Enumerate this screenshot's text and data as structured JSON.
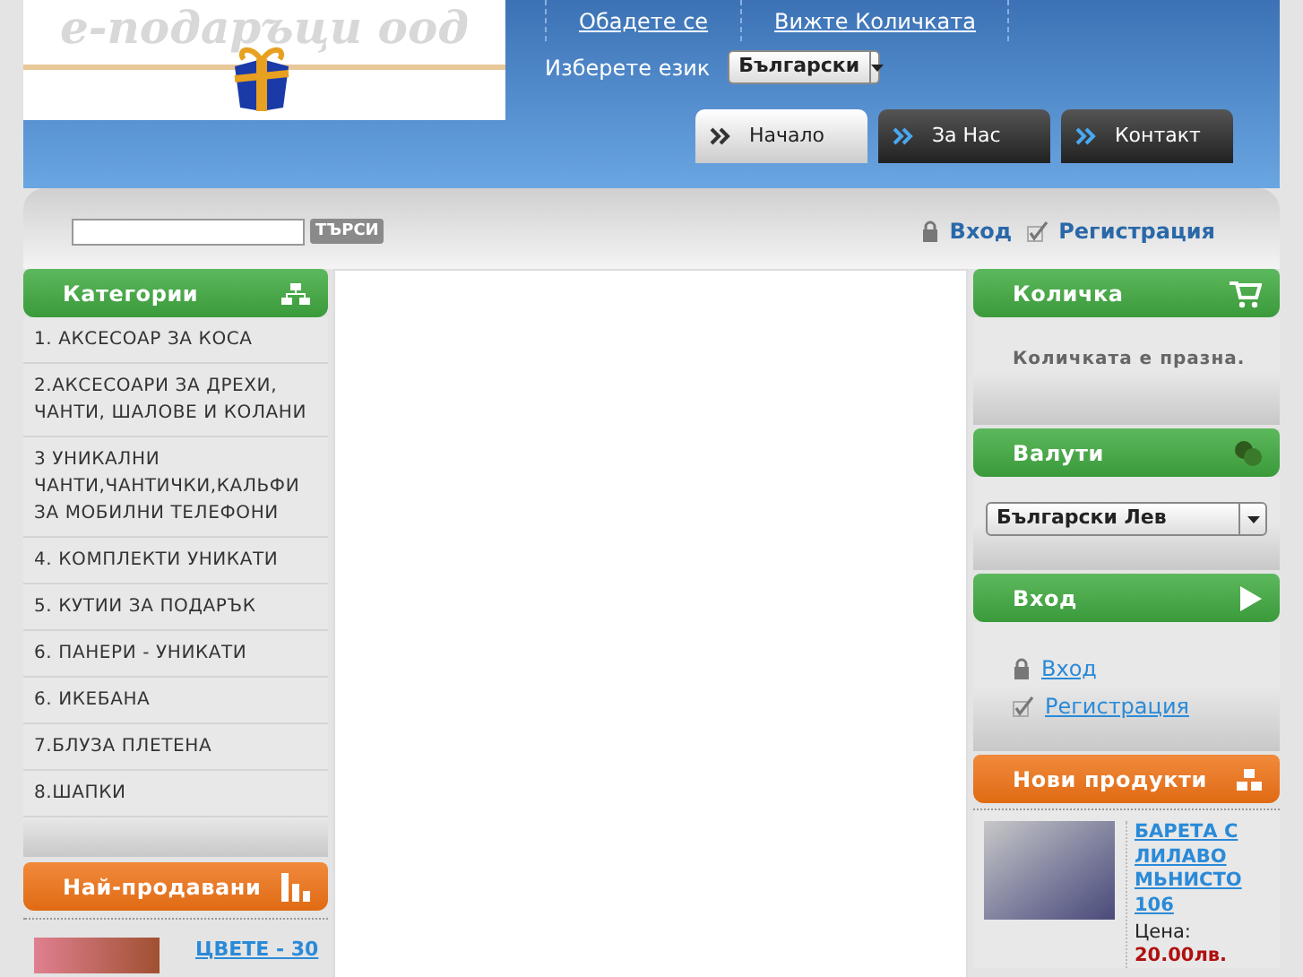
{
  "header": {
    "logo_text": "е-подаръци оод",
    "top_links": [
      "Обадете се",
      "Вижте Количката"
    ],
    "language_label": "Изберете език",
    "language_select": "Български",
    "nav_tabs": [
      {
        "label": "Начало",
        "selected": true
      },
      {
        "label": "За Нас",
        "selected": false
      },
      {
        "label": "Контакт",
        "selected": false
      }
    ]
  },
  "search": {
    "button": "ТЪРСИ",
    "auth_links": [
      {
        "kind": "login",
        "label": "Вход"
      },
      {
        "kind": "register",
        "label": "Регистрация"
      }
    ]
  },
  "left": {
    "categories": {
      "title": "Категории",
      "items": [
        "1. АКСЕСОАР ЗА КОСА",
        "2.АКСЕСОАРИ ЗА ДРЕХИ, ЧАНТИ, ШАЛОВЕ И КОЛАНИ",
        "3 УНИКАЛНИ ЧАНТИ,ЧАНТИЧКИ,КАЛЬФИ ЗА МОБИЛНИ ТЕЛЕФОНИ",
        "4. КОМПЛЕКТИ УНИКАТИ",
        "5. КУТИИ ЗА ПОДАРЪК",
        "6. ПАНЕРИ - УНИКАТИ",
        "6. ИКЕБАНА",
        "7.БЛУЗА ПЛЕТЕНА",
        "8.ШАПКИ"
      ]
    },
    "bestsellers": {
      "title": "Най-продавани",
      "products": [
        {
          "name": "ЦВЕТЕ - 30"
        }
      ]
    }
  },
  "right": {
    "cart": {
      "title": "Количка",
      "empty_text": "Количката е празна."
    },
    "currencies": {
      "title": "Валути",
      "select": "Български Лев"
    },
    "login": {
      "title": "Вход",
      "links": [
        {
          "kind": "login",
          "label": "Вход"
        },
        {
          "kind": "register",
          "label": "Регистрация"
        }
      ]
    },
    "new_products": {
      "title": "Нови продукти",
      "product": {
        "name": "БАРЕТА С ЛИЛАВО МЬНИСТО 106",
        "price_label": "Цена:",
        "price": "20.00лв."
      }
    }
  }
}
